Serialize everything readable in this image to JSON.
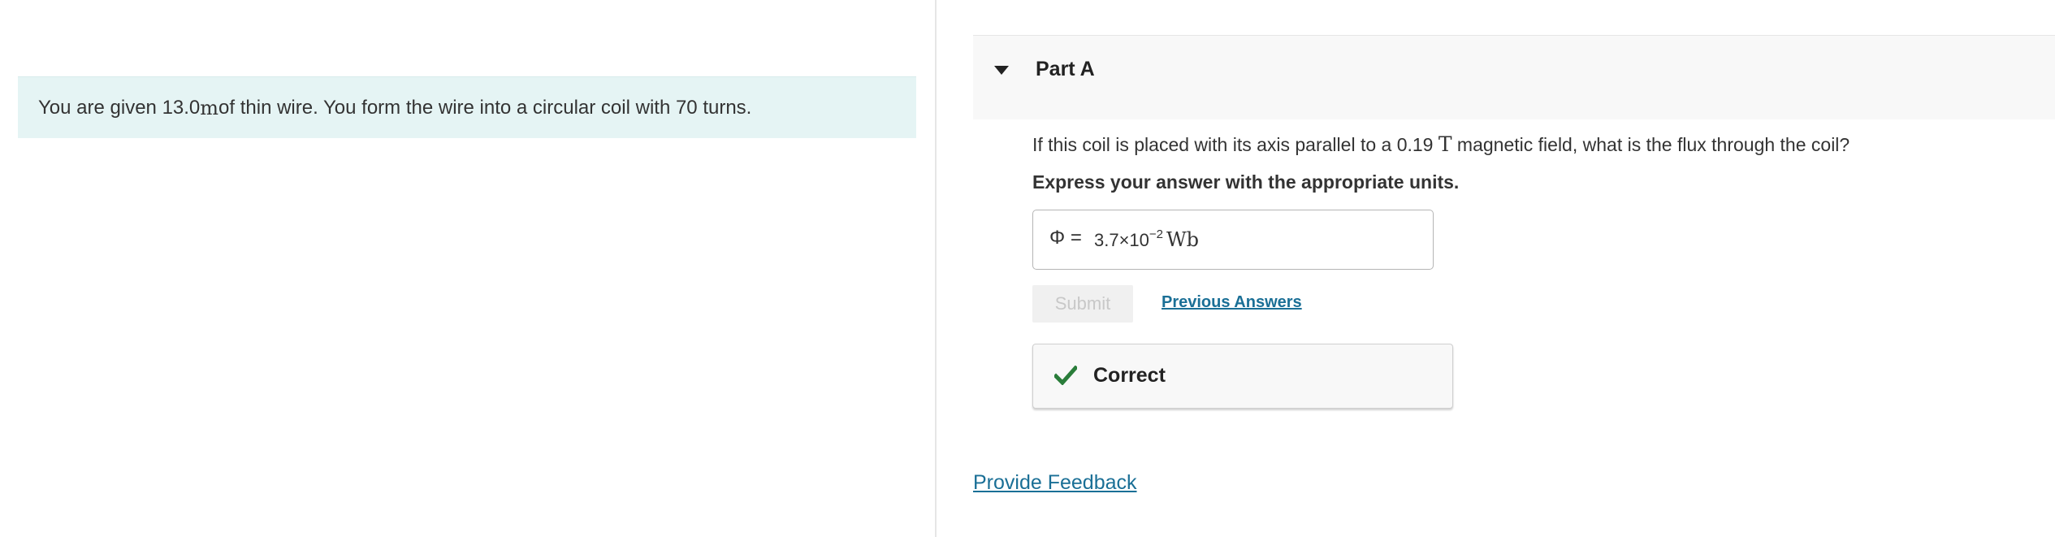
{
  "intro": {
    "text_before": "You are given 13.0 ",
    "unit": "m",
    "text_after": " of thin wire. You form the wire into a circular coil with 70 turns."
  },
  "part": {
    "title": "Part A",
    "question_before": "If this coil is placed with its axis parallel to a 0.19 ",
    "question_unit": "T",
    "question_after": " magnetic field, what is the flux through the coil?",
    "instruction": "Express your answer with the appropriate units."
  },
  "answer": {
    "label": "Φ =",
    "mantissa": "3.7×10",
    "exponent": "−2",
    "unit": "Wb"
  },
  "actions": {
    "submit_label": "Submit",
    "previous_answers_label": "Previous Answers"
  },
  "result": {
    "label": "Correct",
    "color": "#2a7d3a"
  },
  "feedback": {
    "label": "Provide Feedback"
  },
  "colors": {
    "intro_bg": "#e5f4f4",
    "link": "#1a6f96",
    "header_bg": "#f8f8f8"
  }
}
